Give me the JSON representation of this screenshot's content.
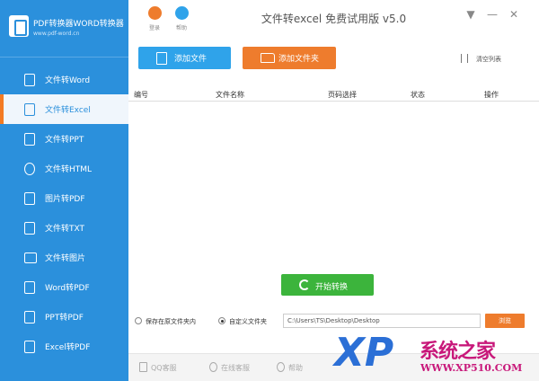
{
  "app": {
    "logo_title": "PDF转换器WORD转换器",
    "logo_subtitle": "www.pdf-word.cn"
  },
  "header": {
    "login_label": "登录",
    "help_label": "帮助",
    "title": "文件转excel  免费试用版  v5.0",
    "minimize_label": "▼",
    "restore_label": "—",
    "close_label": "✕"
  },
  "sidebar": {
    "items": [
      {
        "label": "文件转Word",
        "icon": "word-icon"
      },
      {
        "label": "文件转Excel",
        "icon": "excel-icon"
      },
      {
        "label": "文件转PPT",
        "icon": "ppt-icon"
      },
      {
        "label": "文件转HTML",
        "icon": "html-icon"
      },
      {
        "label": "图片转PDF",
        "icon": "image-pdf-icon"
      },
      {
        "label": "文件转TXT",
        "icon": "txt-icon"
      },
      {
        "label": "文件转图片",
        "icon": "image-icon"
      },
      {
        "label": "Word转PDF",
        "icon": "word-pdf-icon"
      },
      {
        "label": "PPT转PDF",
        "icon": "ppt-pdf-icon"
      },
      {
        "label": "Excel转PDF",
        "icon": "excel-pdf-icon"
      }
    ],
    "active_index": 1
  },
  "toolbar": {
    "add_file_label": "添加文件",
    "add_folder_label": "添加文件夹",
    "clear_list_label": "清空列表"
  },
  "table": {
    "columns": [
      "编号",
      "文件名称",
      "页码选择",
      "状态",
      "操作"
    ]
  },
  "convert": {
    "label": "开始转换"
  },
  "output": {
    "option_original": "保存在原文件夹内",
    "option_custom": "自定义文件夹",
    "selected": "custom",
    "path": "C:\\Users\\TS\\Desktop\\Desktop",
    "browse_label": "浏览"
  },
  "footer": {
    "items": [
      "QQ客服",
      "在线客服",
      "帮助"
    ]
  },
  "watermark": {
    "logo_text": "XP",
    "title": "系统之家",
    "url": "WWW.XP510.COM"
  },
  "colors": {
    "sidebar_bg": "#2b90dc",
    "accent_blue": "#2fa3ea",
    "accent_orange": "#ee7c2d",
    "accent_green": "#3cb43c",
    "watermark": "#c8187a"
  }
}
